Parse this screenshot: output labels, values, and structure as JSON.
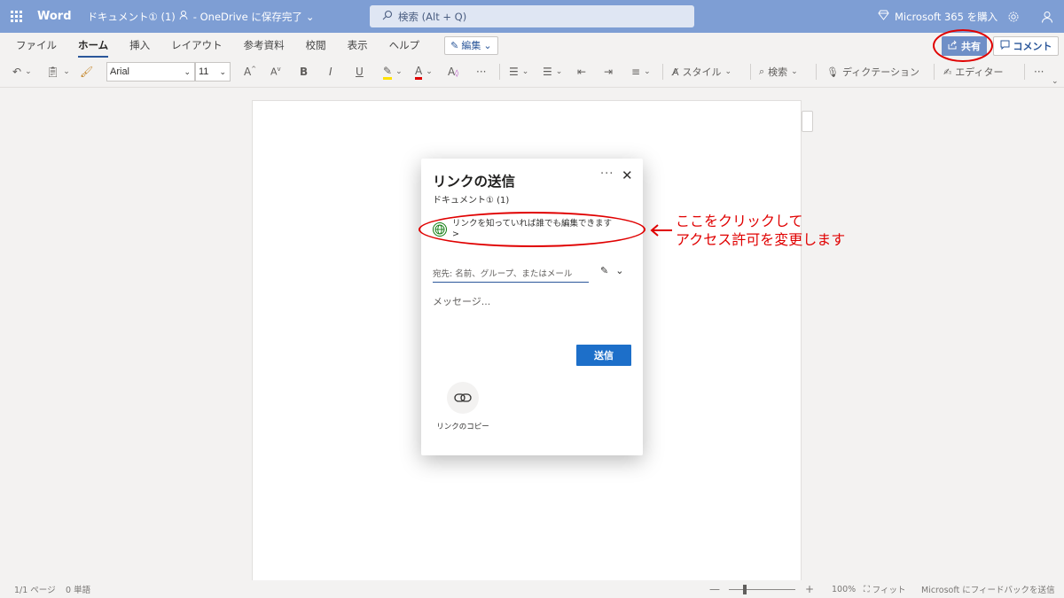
{
  "titlebar": {
    "app_name": "Word",
    "doc_title": "ドキュメント① (1)",
    "save_status": "- OneDrive に保存完了",
    "search_placeholder": "検索 (Alt + Q)",
    "ms365_label": "Microsoft 365 を購入"
  },
  "ribbon": {
    "tabs": [
      {
        "label": "ファイル"
      },
      {
        "label": "ホーム"
      },
      {
        "label": "挿入"
      },
      {
        "label": "レイアウト"
      },
      {
        "label": "参考資料"
      },
      {
        "label": "校閲"
      },
      {
        "label": "表示"
      },
      {
        "label": "ヘルプ"
      }
    ],
    "edit_mode": "編集",
    "share_label": "共有",
    "comment_label": "コメント",
    "font_name": "Arial",
    "font_size": "11",
    "style_label": "スタイル",
    "find_label": "検索",
    "dictation_label": "ディクテーション",
    "editor_label": "エディター"
  },
  "dialog": {
    "title": "リンクの送信",
    "subtitle": "ドキュメント① (1)",
    "link_setting": "リンクを知っていれば誰でも編集できます",
    "link_chevron": ">",
    "to_placeholder": "宛先: 名前、グループ、またはメール",
    "message_placeholder": "メッセージ...",
    "send_label": "送信",
    "copy_link_label": "リンクのコピー"
  },
  "annotation": {
    "line1": "ここをクリックして",
    "line2": "アクセス許可を変更します",
    "color": "#e00000"
  },
  "statusbar": {
    "page": "1/1 ページ",
    "words": "0 単語",
    "zoom": "100%",
    "fit": "フィット",
    "feedback": "Microsoft にフィードバックを送信"
  },
  "colors": {
    "titlebar": "#7e9ed4",
    "accent": "#2b579a",
    "send": "#1d6fc9"
  }
}
